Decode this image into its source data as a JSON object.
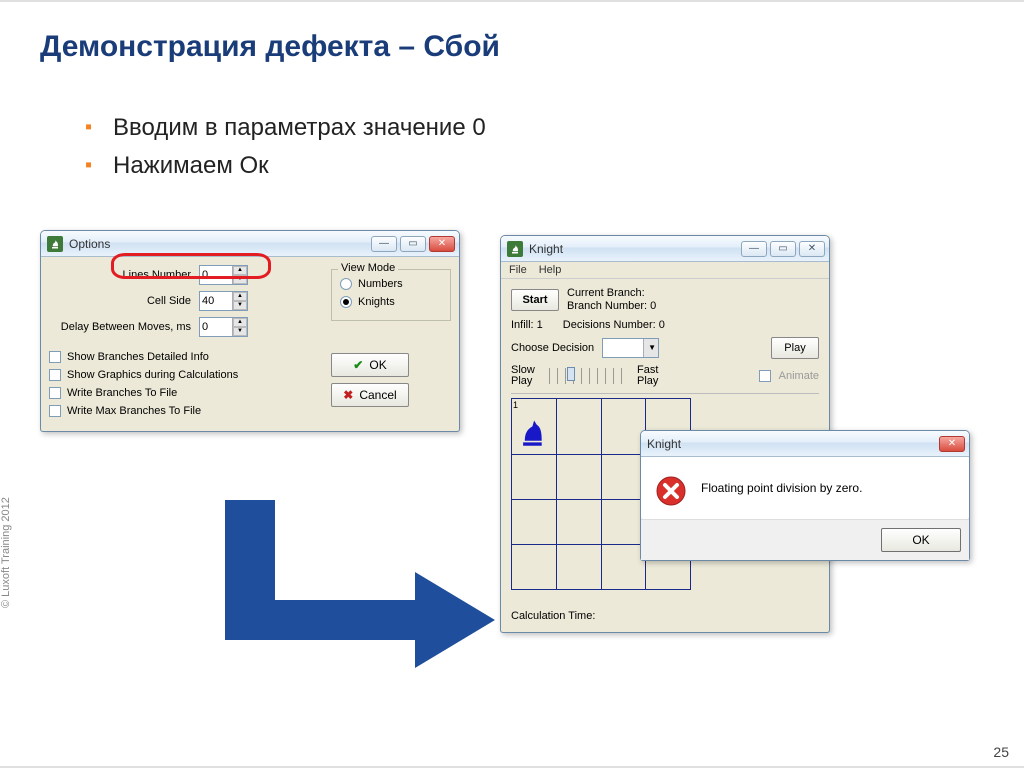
{
  "slide": {
    "title": "Демонстрация дефекта – Сбой",
    "bullet1": "Вводим в параметрах значение 0",
    "bullet2": "Нажимаем Ок",
    "copyright": "© Luxoft Training 2012",
    "page": "25"
  },
  "options": {
    "title": "Options",
    "lines_label": "Lines Number",
    "lines_value": "0",
    "cell_label": "Cell Side",
    "cell_value": "40",
    "delay_label": "Delay Between Moves, ms",
    "delay_value": "0",
    "viewmode_title": "View Mode",
    "radio_numbers": "Numbers",
    "radio_knights": "Knights",
    "chk1": "Show Branches Detailed Info",
    "chk2": "Show Graphics during Calculations",
    "chk3": "Write Branches To File",
    "chk4": "Write Max Branches To File",
    "ok": "OK",
    "cancel": "Cancel"
  },
  "knight": {
    "title": "Knight",
    "menu_file": "File",
    "menu_help": "Help",
    "start": "Start",
    "cur_branch": "Current Branch:",
    "branch_num": "Branch Number: 0",
    "infill": "Infill: 1",
    "dec_num": "Decisions Number:  0",
    "choose": "Choose Decision",
    "play": "Play",
    "slow": "Slow\nPlay",
    "fast": "Fast\nPlay",
    "animate": "Animate",
    "calc_time": "Calculation Time:",
    "cell_label": "1"
  },
  "error": {
    "title": "Knight",
    "message": "Floating point division by zero.",
    "ok": "OK"
  }
}
